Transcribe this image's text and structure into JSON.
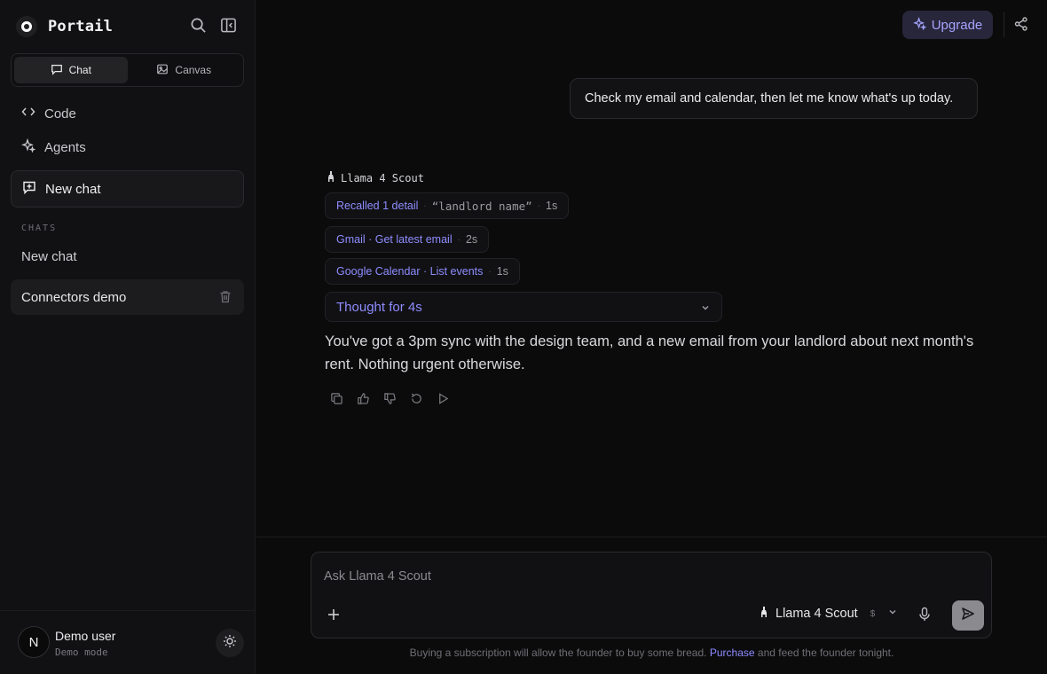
{
  "app": {
    "name": "Portail"
  },
  "sidebar": {
    "tabs": [
      {
        "label": "Chat",
        "icon": "chat-bubble-icon",
        "active": true
      },
      {
        "label": "Canvas",
        "icon": "image-icon",
        "active": false
      }
    ],
    "nav": [
      {
        "label": "Code",
        "icon": "code-icon"
      },
      {
        "label": "Agents",
        "icon": "sparkles-icon"
      }
    ],
    "new_chat_label": "New chat",
    "section_label": "CHATS",
    "chats": [
      {
        "label": "New chat",
        "selected": false
      },
      {
        "label": "Connectors demo",
        "selected": true
      }
    ],
    "user": {
      "initial": "N",
      "name": "Demo user",
      "mode": "Demo mode"
    }
  },
  "header": {
    "upgrade_label": "Upgrade"
  },
  "conversation": {
    "user_message": "Check my email and calendar, then let me know what's up today.",
    "model_name": "Llama 4 Scout",
    "tool_calls": [
      {
        "label": "Recalled 1 detail",
        "detail": "“landlord name”",
        "duration": "1s"
      },
      {
        "label": "Gmail · Get latest email",
        "duration": "2s"
      },
      {
        "label": "Google Calendar · List events",
        "duration": "1s"
      }
    ],
    "thought_label": "Thought for 4s",
    "answer": "You've got a 3pm sync with the design team, and a new email from your landlord about next month's rent. Nothing urgent otherwise."
  },
  "composer": {
    "placeholder": "Ask Llama 4 Scout",
    "model_label": "Llama 4 Scout",
    "price_marker": "$"
  },
  "footer": {
    "before": "Buying a subscription will allow the founder to buy some bread.",
    "link": "Purchase",
    "after": "and feed the founder tonight."
  },
  "colors": {
    "accent": "#8f8cff",
    "background": "#0b0b0c",
    "sidebar": "#111113"
  }
}
